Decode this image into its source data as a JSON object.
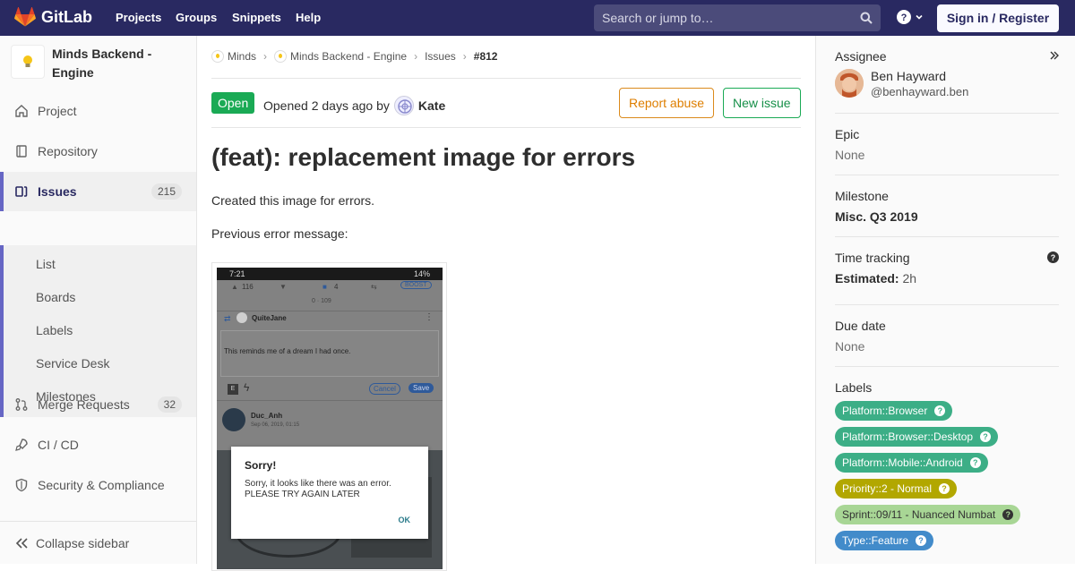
{
  "topbar": {
    "brand": "GitLab",
    "nav": [
      "Projects",
      "Groups",
      "Snippets",
      "Help"
    ],
    "search_placeholder": "Search or jump to…",
    "signin": "Sign in / Register",
    "bg": "#292961"
  },
  "sidebar": {
    "project_name": "Minds Backend - Engine",
    "items": [
      {
        "label": "Project"
      },
      {
        "label": "Repository"
      },
      {
        "label": "Issues",
        "count": "215"
      },
      {
        "label": "Merge Requests",
        "count": "32"
      },
      {
        "label": "CI / CD"
      },
      {
        "label": "Security & Compliance"
      }
    ],
    "issues_sub": [
      "List",
      "Boards",
      "Labels",
      "Service Desk",
      "Milestones"
    ],
    "collapse": "Collapse sidebar"
  },
  "breadcrumb": [
    "Minds",
    "Minds Backend - Engine",
    "Issues",
    "#812"
  ],
  "issue": {
    "status": "Open",
    "opened_text": "Opened 2 days ago by",
    "author": "Kate",
    "report_abuse": "Report abuse",
    "new_issue": "New issue",
    "title": "(feat): replacement image for errors",
    "description": [
      "Created this image for errors.",
      "Previous error message:"
    ]
  },
  "screenshot": {
    "time": "7:21",
    "battery": "14%",
    "likes": "116",
    "comments": "4",
    "boost": "BOOST",
    "views": "0 · 109",
    "user1": "QuiteJane",
    "comment_text": "This reminds me of a dream I had once.",
    "cancel": "Cancel",
    "save": "Save",
    "user2": "Duc_Anh",
    "date2": "Sep 06, 2019, 01:15",
    "dialog_title": "Sorry!",
    "dialog_text_1": "Sorry, it looks like there was an error.",
    "dialog_text_2": "PLEASE TRY AGAIN LATER",
    "dialog_ok": "OK"
  },
  "right": {
    "assignee_title": "Assignee",
    "assignee_name": "Ben Hayward",
    "assignee_handle": "@benhayward.ben",
    "epic_title": "Epic",
    "epic_value": "None",
    "milestone_title": "Milestone",
    "milestone_value": "Misc. Q3 2019",
    "time_title": "Time tracking",
    "time_label": "Estimated:",
    "time_value": "2h",
    "due_title": "Due date",
    "due_value": "None",
    "labels_title": "Labels",
    "labels": [
      {
        "text": "Platform::Browser",
        "color": "#3cae86",
        "fg": "#ffffff"
      },
      {
        "text": "Platform::Browser::Desktop",
        "color": "#3cae86",
        "fg": "#ffffff"
      },
      {
        "text": "Platform::Mobile::Android",
        "color": "#3cae86",
        "fg": "#ffffff"
      },
      {
        "text": "Priority::2 - Normal",
        "color": "#b2a700",
        "fg": "#ffffff"
      },
      {
        "text": "Sprint::09/11 - Nuanced Numbat",
        "color": "#a8d695",
        "fg": "#333333"
      },
      {
        "text": "Type::Feature",
        "color": "#428bca",
        "fg": "#ffffff"
      }
    ]
  }
}
